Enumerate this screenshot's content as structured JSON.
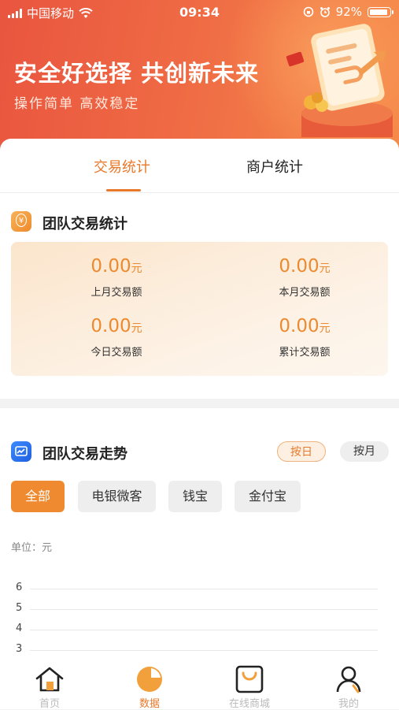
{
  "status_bar": {
    "carrier": "中国移动",
    "time": "09:34",
    "battery": "92%"
  },
  "banner": {
    "title": "安全好选择 共创新未来",
    "subtitle": "操作简单 高效稳定"
  },
  "tabs": [
    {
      "label": "交易统计",
      "active": true
    },
    {
      "label": "商户统计",
      "active": false
    }
  ],
  "team_stats": {
    "title": "团队交易统计",
    "icon": "yen-icon",
    "items": [
      {
        "value": "0.00",
        "unit": "元",
        "label": "上月交易额"
      },
      {
        "value": "0.00",
        "unit": "元",
        "label": "本月交易额"
      },
      {
        "value": "0.00",
        "unit": "元",
        "label": "今日交易额"
      },
      {
        "value": "0.00",
        "unit": "元",
        "label": "累计交易额"
      }
    ]
  },
  "trend": {
    "title": "团队交易走势",
    "icon": "chart-icon",
    "toggles": [
      {
        "label": "按日",
        "active": true
      },
      {
        "label": "按月",
        "active": false
      }
    ],
    "filters": [
      {
        "label": "全部",
        "active": true
      },
      {
        "label": "电银微客",
        "active": false
      },
      {
        "label": "钱宝",
        "active": false
      },
      {
        "label": "金付宝",
        "active": false
      }
    ],
    "unit_label": "单位：元",
    "y_ticks": [
      "6",
      "5",
      "4",
      "3"
    ]
  },
  "tabbar": [
    {
      "label": "首页",
      "icon": "home-icon",
      "active": false
    },
    {
      "label": "数据",
      "icon": "pie-chart-icon",
      "active": true
    },
    {
      "label": "在线商城",
      "icon": "shopping-bag-icon",
      "active": false
    },
    {
      "label": "我的",
      "icon": "user-icon",
      "active": false
    }
  ],
  "colors": {
    "accent": "#E8792B",
    "banner_start": "#E9553F",
    "banner_end": "#F58A4A"
  }
}
